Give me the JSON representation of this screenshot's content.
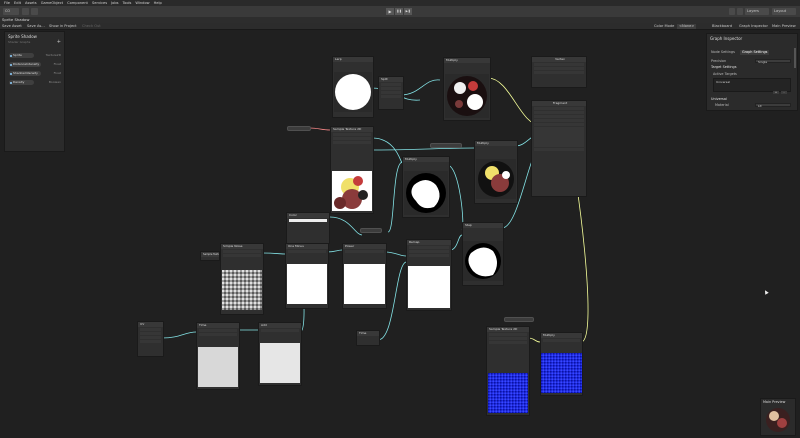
{
  "menubar": {
    "items": [
      "File",
      "Edit",
      "Assets",
      "GameObject",
      "Component",
      "Services",
      "Jobs",
      "Tools",
      "Window",
      "Help"
    ]
  },
  "toolbar": {
    "account_label": "CO",
    "play_glyph": "▶",
    "pause_glyph": "❚❚",
    "step_glyph": "▶❚",
    "layers_label": "Layers",
    "layout_label": "Layout"
  },
  "tab": {
    "title": "Sprite Shadow"
  },
  "graph_toolbar": {
    "save_asset": "Save Asset",
    "save_as": "Save As...",
    "show_in_project": "Show in Project",
    "check_out": "Check Out",
    "color_mode_label": "Color Mode",
    "color_mode_value": "<None>",
    "blackboard": "Blackboard",
    "graph_inspector": "Graph Inspector",
    "main_preview": "Main Preview"
  },
  "blackboard": {
    "title": "Sprite Shadow",
    "subtitle": "Shader Graphs",
    "properties": [
      {
        "name": "Sprite",
        "value": "Texture2D"
      },
      {
        "name": "DistanceIntensity",
        "value": "Float"
      },
      {
        "name": "ShadowIntensity",
        "value": "Float"
      },
      {
        "name": "Density",
        "value": "Boolean"
      }
    ]
  },
  "inspector": {
    "title": "Graph Inspector",
    "tabs": [
      "Node Settings",
      "Graph Settings"
    ],
    "precision_label": "Precision",
    "precision_value": "Single",
    "target_settings": "Target Settings",
    "active_targets": "Active Targets",
    "target_item": "Universal",
    "universal_section": "Universal",
    "material_label": "Material",
    "material_value": "Lit"
  },
  "nodes": {
    "sample_tex_a": "Sample Texture 2D",
    "sample_tex_b": "Sample Texture 2D",
    "lerp": "Lerp",
    "multiply_top": "Multiply",
    "multiply_mid": "Multiply",
    "multiply_center": "Multiply",
    "step": "Step",
    "vertex": "Vertex",
    "fragment": "Fragment",
    "simple_noise": "Simple Noise",
    "one_minus": "One Minus",
    "power": "Power",
    "remap": "Remap",
    "uv": "UV",
    "time": "Time",
    "add": "Add",
    "split": "Split",
    "color": "Color",
    "multiply_blue": "Multiply",
    "sample_tex_c": "Sample Texture 2D"
  },
  "preview": {
    "title": "Main Preview"
  },
  "colors": {
    "graph_bg": "#202020",
    "wire_float": "#84e4e7",
    "wire_vector": "#f6ff9a",
    "wire_tex": "#ff8b8b",
    "accent_blue": "#1d2be0"
  }
}
